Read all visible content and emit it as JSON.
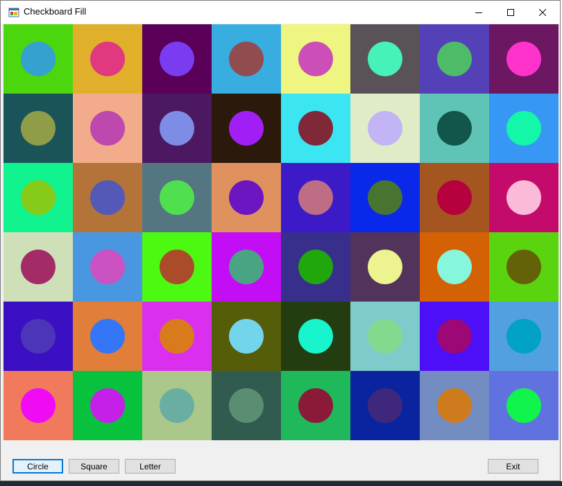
{
  "window": {
    "title": "Checkboard Fill",
    "icon": "app-window-icon",
    "controls": [
      "minimize-icon",
      "maximize-icon",
      "close-icon"
    ]
  },
  "board": {
    "rows": 6,
    "cols": 8,
    "cells": [
      [
        {
          "bg": "#4cd60d",
          "disc": "#35a1cf"
        },
        {
          "bg": "#e0b02a",
          "disc": "#e0397f"
        },
        {
          "bg": "#5a0058",
          "disc": "#7a3cf0"
        },
        {
          "bg": "#38ade0",
          "disc": "#914c4f"
        },
        {
          "bg": "#eef580",
          "disc": "#cc4fb7"
        },
        {
          "bg": "#5a5259",
          "disc": "#46f2b8"
        },
        {
          "bg": "#5541b7",
          "disc": "#4dbb68"
        },
        {
          "bg": "#6c1761",
          "disc": "#ff32cb"
        }
      ],
      [
        {
          "bg": "#1a5459",
          "disc": "#8f9c48"
        },
        {
          "bg": "#f2ab8b",
          "disc": "#bd48ae"
        },
        {
          "bg": "#4b1861",
          "disc": "#7d8ce4"
        },
        {
          "bg": "#2b1a0c",
          "disc": "#a11ff5"
        },
        {
          "bg": "#3ce5f2",
          "disc": "#7f2838"
        },
        {
          "bg": "#e0ecc8",
          "disc": "#c3b4f5"
        },
        {
          "bg": "#5fc3b5",
          "disc": "#11554b"
        },
        {
          "bg": "#3697f4",
          "disc": "#14f7a8"
        }
      ],
      [
        {
          "bg": "#11f38f",
          "disc": "#86cb1a"
        },
        {
          "bg": "#b37339",
          "disc": "#5459b7"
        },
        {
          "bg": "#547681",
          "disc": "#50e04f"
        },
        {
          "bg": "#e0925e",
          "disc": "#6b16c0"
        },
        {
          "bg": "#3c1ac8",
          "disc": "#be6e84"
        },
        {
          "bg": "#0a28ea",
          "disc": "#477431"
        },
        {
          "bg": "#a5551f",
          "disc": "#b5013e"
        },
        {
          "bg": "#c40b6c",
          "disc": "#fbbad8"
        }
      ],
      [
        {
          "bg": "#cfe0b8",
          "disc": "#a42c66"
        },
        {
          "bg": "#4a97e1",
          "disc": "#cb52c2"
        },
        {
          "bg": "#4cf910",
          "disc": "#aa4c29"
        },
        {
          "bg": "#c30ef5",
          "disc": "#4aa484"
        },
        {
          "bg": "#382f8d",
          "disc": "#1fa70b"
        },
        {
          "bg": "#52335b",
          "disc": "#ecf38f"
        },
        {
          "bg": "#d46104",
          "disc": "#86f6dc"
        },
        {
          "bg": "#5ad40f",
          "disc": "#636209"
        }
      ],
      [
        {
          "bg": "#3a10c2",
          "disc": "#4c35b8"
        },
        {
          "bg": "#e07e3a",
          "disc": "#3476f5"
        },
        {
          "bg": "#db2ff0",
          "disc": "#d97b1c"
        },
        {
          "bg": "#555d09",
          "disc": "#72d5ec"
        },
        {
          "bg": "#233d10",
          "disc": "#18f4cc"
        },
        {
          "bg": "#7ecbcb",
          "disc": "#83da8f"
        },
        {
          "bg": "#4d0ef8",
          "disc": "#9c0875"
        },
        {
          "bg": "#52a0e0",
          "disc": "#01a1c8"
        }
      ],
      [
        {
          "bg": "#f27a5c",
          "disc": "#ef0cf5"
        },
        {
          "bg": "#08c23e",
          "disc": "#c420e8"
        },
        {
          "bg": "#abc88a",
          "disc": "#6aaea2"
        },
        {
          "bg": "#325b50",
          "disc": "#5a8e72"
        },
        {
          "bg": "#1fb85a",
          "disc": "#8b1a38"
        },
        {
          "bg": "#0a24a0",
          "disc": "#3f287c"
        },
        {
          "bg": "#738dc2",
          "disc": "#cd7b1d"
        },
        {
          "bg": "#5f72e0",
          "disc": "#10f44b"
        }
      ]
    ]
  },
  "buttons": {
    "circle": "Circle",
    "square": "Square",
    "letter": "Letter",
    "exit": "Exit"
  }
}
